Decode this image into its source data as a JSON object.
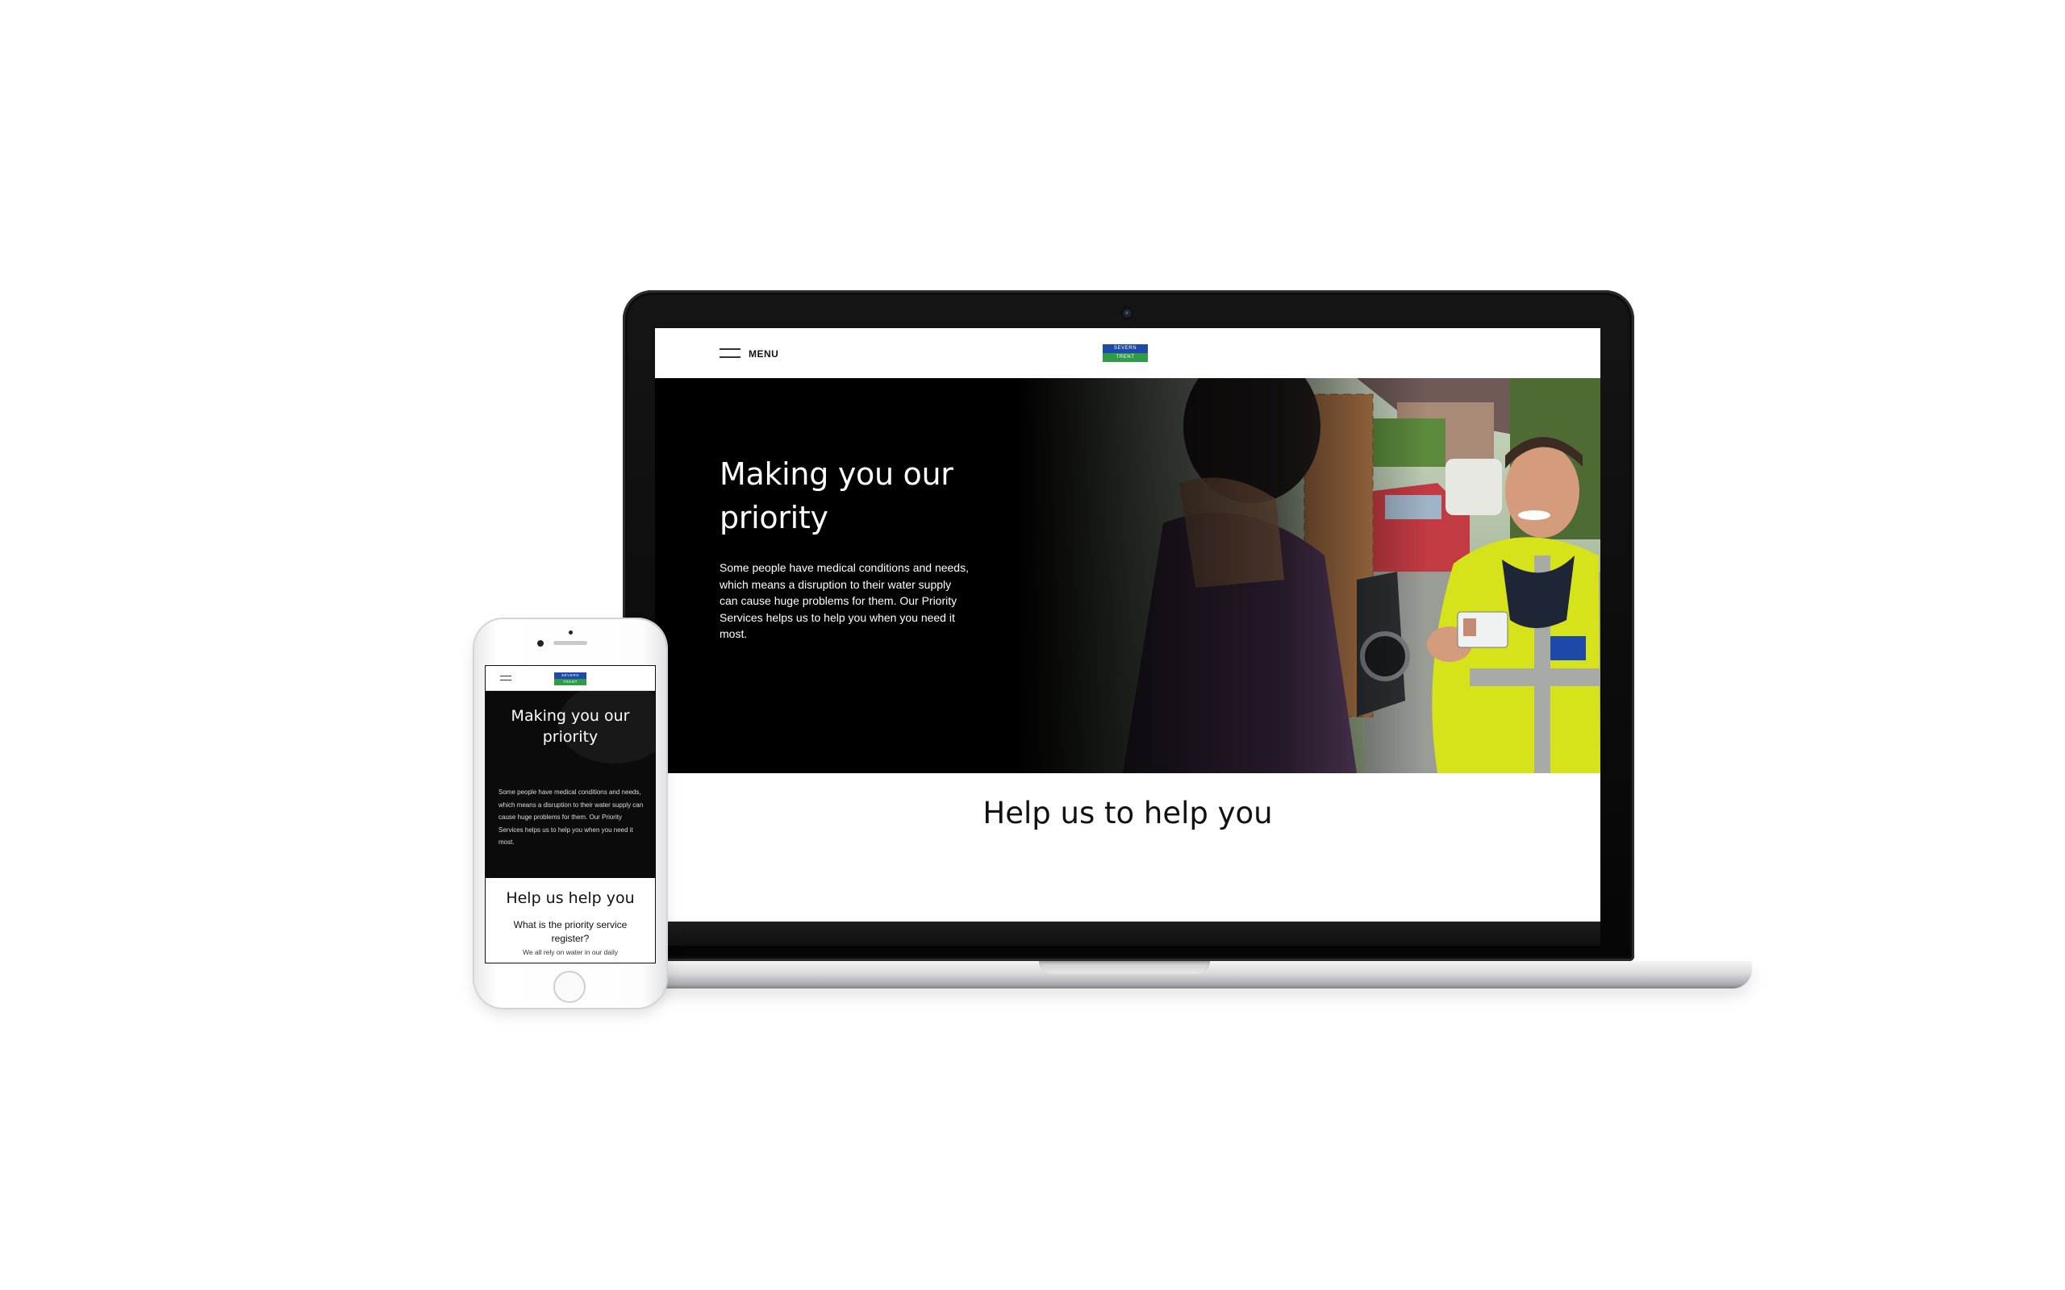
{
  "laptop_site": {
    "header": {
      "menu_label": "MENU",
      "logo_top": "SEVERN",
      "logo_bottom": "TRENT",
      "logo_colors": {
        "top": "#1d4aa8",
        "bottom": "#2f9a47"
      }
    },
    "hero": {
      "title": "Making you our priority",
      "body": "Some people have medical conditions and needs, which means a disruption to their water supply can cause huge problems for them. Our Priority Services helps us to help you when you need it most.",
      "background": "#000000"
    },
    "section_heading": "Help us to help you"
  },
  "phone_site": {
    "logo_top": "SEVERN",
    "logo_bottom": "TRENT",
    "hero_title": "Making you our priority",
    "hero_body": "Some people have medical conditions and needs, which means a disruption to their water supply can cause huge problems for them. Our Priority Services helps us to help you when you need it most.",
    "section_heading": "Help us help you",
    "question": "What is the priority service register?",
    "snippet": "We all rely on water in our daily"
  },
  "icons": {
    "menu": "hamburger-icon",
    "camera": "camera-icon",
    "home_button": "home-button-icon"
  }
}
